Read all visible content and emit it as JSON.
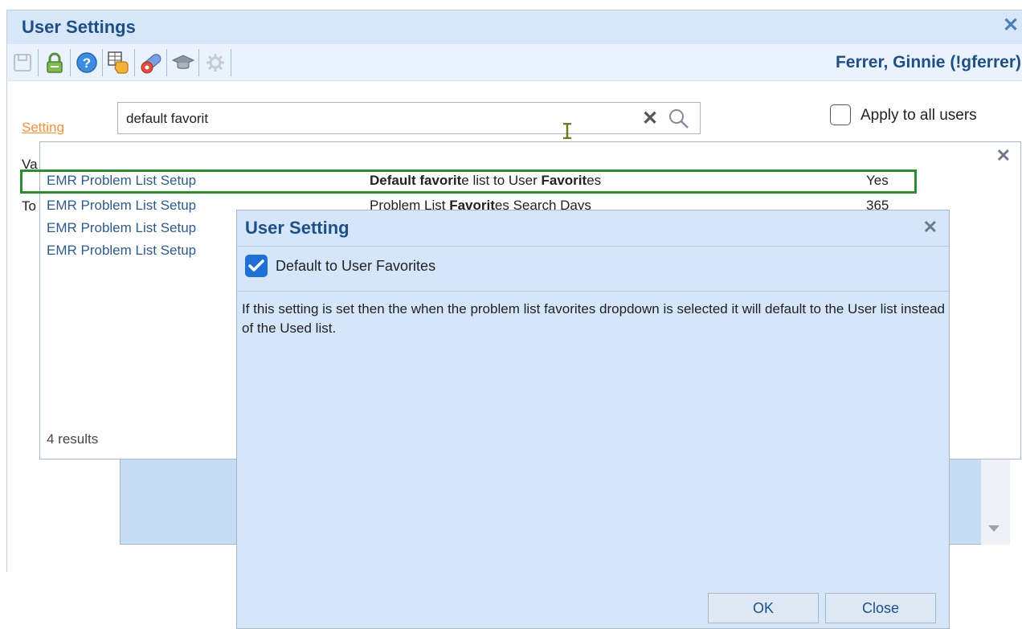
{
  "window": {
    "title": "User Settings",
    "close_icon": "close-icon",
    "user_name": "Ferrer, Ginnie (!gferrer)"
  },
  "toolbar": {
    "icons": [
      "save-icon",
      "lock-icon",
      "help-icon",
      "hand-grid-icon",
      "pill-gear-icon",
      "graduation-cap-icon",
      "gear-icon"
    ]
  },
  "search": {
    "label": "Setting",
    "value": "default favorit"
  },
  "apply_all": {
    "label": "Apply to all users",
    "checked": false
  },
  "background": {
    "value_label_partial": "Va",
    "to_label_partial": "To"
  },
  "dropdown": {
    "rows": [
      {
        "category": "EMR Problem List Setup",
        "desc_bold1": "Default favorit",
        "desc_plain1": "e list to User ",
        "desc_bold2": "Favorit",
        "desc_plain2": "es",
        "value": "Yes",
        "selected": true
      },
      {
        "category": "EMR Problem List Setup",
        "desc_plain0": "Problem List ",
        "desc_bold1": "Favorit",
        "desc_plain1": "es Search Days",
        "value": "365"
      },
      {
        "category": "EMR Problem List Setup"
      },
      {
        "category": "EMR Problem List Setup"
      }
    ],
    "results_text": "4 results"
  },
  "dialog": {
    "title": "User Setting",
    "checkbox_label": "Default to User Favorites",
    "checkbox_checked": true,
    "description": "If this setting is set then the when the problem list favorites dropdown is selected it will default to the User list instead of the Used list.",
    "ok_label": "OK",
    "close_label": "Close"
  },
  "colors": {
    "title_blue": "#1e4f86",
    "setting_orange": "#f0913a",
    "selection_green": "#2e8b2e",
    "dialog_bg": "#d6e6fa",
    "checkbox_blue": "#1f6fd6"
  }
}
